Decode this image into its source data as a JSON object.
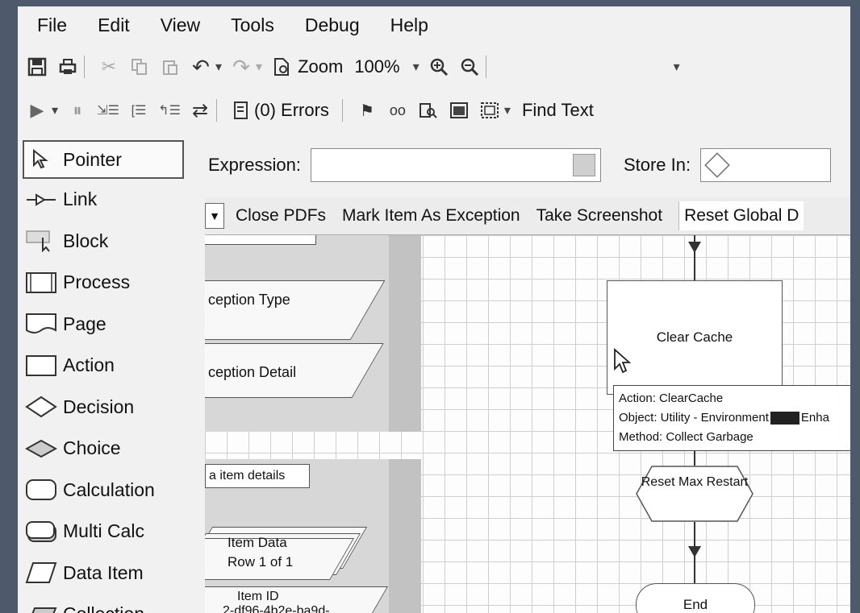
{
  "menu": [
    "File",
    "Edit",
    "View",
    "Tools",
    "Debug",
    "Help"
  ],
  "toolbar1": {
    "zoom_label": "Zoom",
    "zoom_value": "100%",
    "icons": [
      "save-icon",
      "print-icon",
      "cut-icon",
      "copy-icon",
      "paste-icon",
      "undo-icon",
      "redo-icon",
      "zoom-fit-icon",
      "zoom-in-icon",
      "zoom-out-icon"
    ]
  },
  "toolbar2": {
    "errors_label": "(0) Errors",
    "find_text_label": "Find Text"
  },
  "palette": [
    {
      "label": "Pointer",
      "icon": "pointer-icon",
      "selected": true
    },
    {
      "label": "Link",
      "icon": "link-icon"
    },
    {
      "label": "Block",
      "icon": "block-icon"
    },
    {
      "label": "Process",
      "icon": "process-icon"
    },
    {
      "label": "Page",
      "icon": "page-icon"
    },
    {
      "label": "Action",
      "icon": "action-icon"
    },
    {
      "label": "Decision",
      "icon": "decision-icon"
    },
    {
      "label": "Choice",
      "icon": "choice-icon"
    },
    {
      "label": "Calculation",
      "icon": "calculation-icon"
    },
    {
      "label": "Multi Calc",
      "icon": "multi-calc-icon"
    },
    {
      "label": "Data Item",
      "icon": "data-item-icon"
    },
    {
      "label": "Collection",
      "icon": "collection-icon"
    }
  ],
  "expression": {
    "label": "Expression:",
    "value": "",
    "store_label": "Store In:",
    "store_value": ""
  },
  "page_tabs": [
    "Close PDFs",
    "Mark Item As Exception",
    "Take Screenshot",
    "Reset Global D"
  ],
  "canvas": {
    "left_items": {
      "exception_type": "ception Type",
      "exception_detail": "ception Detail",
      "item_details": "a item details",
      "item_data": "Item Data",
      "item_data_row": "Row 1 of 1",
      "item_id": "Item ID",
      "item_id_value": "2-df96-4b2e-ba9d-"
    },
    "action": "Clear Cache",
    "tooltip": {
      "action": "Action: ClearCache",
      "object_prefix": "Object: Utility - Environment",
      "object_suffix": "Enha",
      "method": "Method: Collect Garbage"
    },
    "decision": "Reset Max Restart",
    "end": "End"
  }
}
